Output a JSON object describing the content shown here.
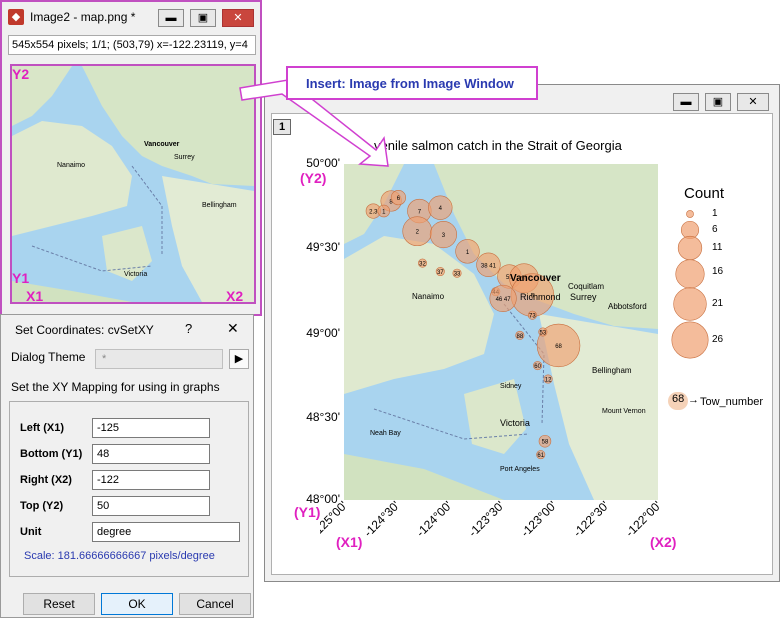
{
  "image_window": {
    "title": "Image2 - map.png *",
    "status": "545x554 pixels; 1/1; (503,79) x=-122.23119, y=4",
    "labels": {
      "y2": "Y2",
      "y1": "Y1",
      "x1": "X1",
      "x2": "X2"
    },
    "map_places": [
      "Vancouver",
      "Nanaimo",
      "Surrey",
      "Bellingham",
      "Victoria"
    ]
  },
  "callout": {
    "text": "Insert: Image from Image Window"
  },
  "graph_window": {
    "layer_tab": "1",
    "title": "venile salmon catch in the Strait of Georgia",
    "map_places": [
      "Vancouver",
      "Richmond",
      "Coquitlam",
      "Surrey",
      "Abbotsford",
      "Nanaimo",
      "Bellingham",
      "Victoria",
      "Sidney",
      "Mount Vernon",
      "Port Angeles",
      "Neah Bay"
    ],
    "axis_markers": {
      "y2": "(Y2)",
      "y1": "(Y1)",
      "x1": "(X1)",
      "x2": "(X2)"
    },
    "legend": {
      "title": "Count",
      "items": [
        "1",
        "6",
        "11",
        "16",
        "21",
        "26"
      ],
      "tow_sample": "68",
      "tow_label": "Tow_number"
    }
  },
  "chart_data": {
    "type": "scatter",
    "title": "venile salmon catch in the Strait of Georgia",
    "xlim": [
      -125,
      -122
    ],
    "ylim": [
      48,
      50
    ],
    "x_ticks": [
      "-125°00'",
      "-124°30'",
      "-124°00'",
      "-123°30'",
      "-123°00'",
      "-122°30'",
      "-122°00'"
    ],
    "y_ticks": [
      "50°00'",
      "49°30'",
      "49°00'",
      "48°30'",
      "48°00'"
    ],
    "size_legend": {
      "title": "Count",
      "levels": [
        1,
        6,
        11,
        16,
        21,
        26
      ]
    },
    "points": [
      {
        "lon": -124.55,
        "lat": 49.78,
        "label": "8",
        "count": 6
      },
      {
        "lon": -124.48,
        "lat": 49.8,
        "label": "6",
        "count": 3
      },
      {
        "lon": -124.72,
        "lat": 49.72,
        "label": "2.3",
        "count": 3
      },
      {
        "lon": -124.62,
        "lat": 49.72,
        "label": "1",
        "count": 2
      },
      {
        "lon": -124.28,
        "lat": 49.72,
        "label": "7",
        "count": 8
      },
      {
        "lon": -124.08,
        "lat": 49.74,
        "label": "4",
        "count": 8
      },
      {
        "lon": -124.3,
        "lat": 49.6,
        "label": "2",
        "count": 12
      },
      {
        "lon": -124.05,
        "lat": 49.58,
        "label": "3",
        "count": 10
      },
      {
        "lon": -123.82,
        "lat": 49.48,
        "label": "1",
        "count": 8
      },
      {
        "lon": -124.25,
        "lat": 49.41,
        "label": "32",
        "count": 1
      },
      {
        "lon": -123.62,
        "lat": 49.4,
        "label": "38 41",
        "count": 8
      },
      {
        "lon": -123.42,
        "lat": 49.33,
        "label": "51",
        "count": 8
      },
      {
        "lon": -123.28,
        "lat": 49.32,
        "label": "56",
        "count": 12
      },
      {
        "lon": -123.2,
        "lat": 49.22,
        "label": "5",
        "count": 26
      },
      {
        "lon": -123.55,
        "lat": 49.24,
        "label": "44",
        "count": 1
      },
      {
        "lon": -123.48,
        "lat": 49.2,
        "label": "46 47",
        "count": 10
      },
      {
        "lon": -124.08,
        "lat": 49.36,
        "label": "37",
        "count": 1
      },
      {
        "lon": -123.92,
        "lat": 49.35,
        "label": "33",
        "count": 1
      },
      {
        "lon": -123.2,
        "lat": 49.1,
        "label": "73",
        "count": 1
      },
      {
        "lon": -123.32,
        "lat": 48.98,
        "label": "88",
        "count": 1
      },
      {
        "lon": -122.95,
        "lat": 48.92,
        "label": "68",
        "count": 26
      },
      {
        "lon": -123.1,
        "lat": 49.0,
        "label": "53",
        "count": 1
      },
      {
        "lon": -123.15,
        "lat": 48.8,
        "label": "60",
        "count": 1
      },
      {
        "lon": -123.05,
        "lat": 48.72,
        "label": "12",
        "count": 1
      },
      {
        "lon": -123.08,
        "lat": 48.35,
        "label": "58",
        "count": 2
      },
      {
        "lon": -123.12,
        "lat": 48.27,
        "label": "61",
        "count": 1
      }
    ]
  },
  "dialog": {
    "title": "Set Coordinates: cvSetXY",
    "help": "?",
    "close": "✕",
    "theme_label": "Dialog Theme",
    "theme_value": "*",
    "theme_arrow": "▶",
    "description": "Set the XY Mapping for using in graphs",
    "fields": [
      {
        "label": "Left (X1)",
        "value": "-125"
      },
      {
        "label": "Bottom (Y1)",
        "value": "48"
      },
      {
        "label": "Right (X2)",
        "value": "-122"
      },
      {
        "label": "Top (Y2)",
        "value": "50"
      },
      {
        "label": "Unit",
        "value": "degree"
      }
    ],
    "scale": "Scale: 181.66666666667 pixels/degree",
    "buttons": {
      "reset": "Reset",
      "ok": "OK",
      "cancel": "Cancel"
    }
  },
  "colors": {
    "accent": "#d040d0",
    "bubble": "#f0a070",
    "link": "#2a3ab0"
  }
}
